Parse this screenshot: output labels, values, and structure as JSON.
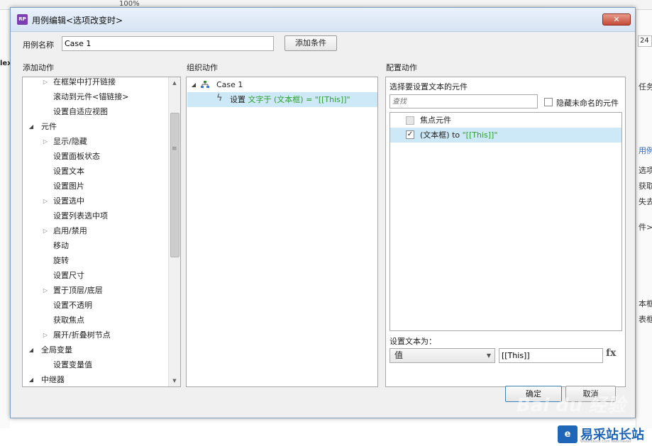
{
  "background": {
    "zoom": "100%",
    "left_fragment": "lex",
    "right_fragments": {
      "top": "任务",
      "input": "24",
      "r1": "用例",
      "r2": "选项改",
      "r3": "获取焦",
      "r4": "失去焦",
      "r5": "件>>",
      "r6": "本框",
      "r7": "表框"
    }
  },
  "dialog": {
    "title": "用例编辑<选项改变时>",
    "app_icon": "RP",
    "close_symbol": "✕",
    "case_name_label": "用例名称",
    "case_name_value": "Case 1",
    "add_condition_label": "添加条件",
    "ok_label": "确定",
    "cancel_label": "取消"
  },
  "panels": {
    "add_actions": {
      "title": "添加动作",
      "items": [
        {
          "label": "在框架中打开链接",
          "level": 1,
          "expander": "collapsed"
        },
        {
          "label": "滚动到元件<锚链接>",
          "level": 1,
          "expander": "none"
        },
        {
          "label": "设置自适应视图",
          "level": 1,
          "expander": "none"
        },
        {
          "label": "元件",
          "level": 0,
          "expander": "expanded"
        },
        {
          "label": "显示/隐藏",
          "level": 1,
          "expander": "collapsed"
        },
        {
          "label": "设置面板状态",
          "level": 1,
          "expander": "none"
        },
        {
          "label": "设置文本",
          "level": 1,
          "expander": "none"
        },
        {
          "label": "设置图片",
          "level": 1,
          "expander": "none"
        },
        {
          "label": "设置选中",
          "level": 1,
          "expander": "collapsed"
        },
        {
          "label": "设置列表选中项",
          "level": 1,
          "expander": "none"
        },
        {
          "label": "启用/禁用",
          "level": 1,
          "expander": "collapsed"
        },
        {
          "label": "移动",
          "level": 1,
          "expander": "none"
        },
        {
          "label": "旋转",
          "level": 1,
          "expander": "none"
        },
        {
          "label": "设置尺寸",
          "level": 1,
          "expander": "none"
        },
        {
          "label": "置于顶层/底层",
          "level": 1,
          "expander": "collapsed"
        },
        {
          "label": "设置不透明",
          "level": 1,
          "expander": "none"
        },
        {
          "label": "获取焦点",
          "level": 1,
          "expander": "none"
        },
        {
          "label": "展开/折叠树节点",
          "level": 1,
          "expander": "collapsed"
        },
        {
          "label": "全局变量",
          "level": 0,
          "expander": "expanded"
        },
        {
          "label": "设置变量值",
          "level": 1,
          "expander": "none"
        },
        {
          "label": "中继器",
          "level": 0,
          "expander": "expanded"
        }
      ]
    },
    "organize_actions": {
      "title": "组织动作",
      "case_label": "Case 1",
      "action_prefix": "设置 ",
      "action_target": "文字于 (文本框) = \"[[This]]\""
    },
    "configure_actions": {
      "title": "配置动作",
      "select_widget_label": "选择要设置文本的元件",
      "search_placeholder": "查找",
      "hide_unnamed_label": "隐藏未命名的元件",
      "widgets": [
        {
          "label": "焦点元件",
          "checked": false,
          "enabled": false
        },
        {
          "label_prefix": "(文本框) to ",
          "label_value": "\"[[This]]\"",
          "checked": true,
          "enabled": true
        }
      ],
      "set_text_label": "设置文本为：",
      "type_selected": "值",
      "value": "[[This]]",
      "fx_label": "fx"
    }
  },
  "watermark": {
    "site_name": "易采站长站",
    "site_sub": "Www.Easck.Com Webmaster",
    "logo_char": "e",
    "baidu": "Bai du 经验"
  },
  "colors": {
    "selection": "#cde8f6",
    "action_green": "#2e9e2e",
    "close_red": "#c44a36",
    "watermark_blue": "#1f66b8"
  }
}
